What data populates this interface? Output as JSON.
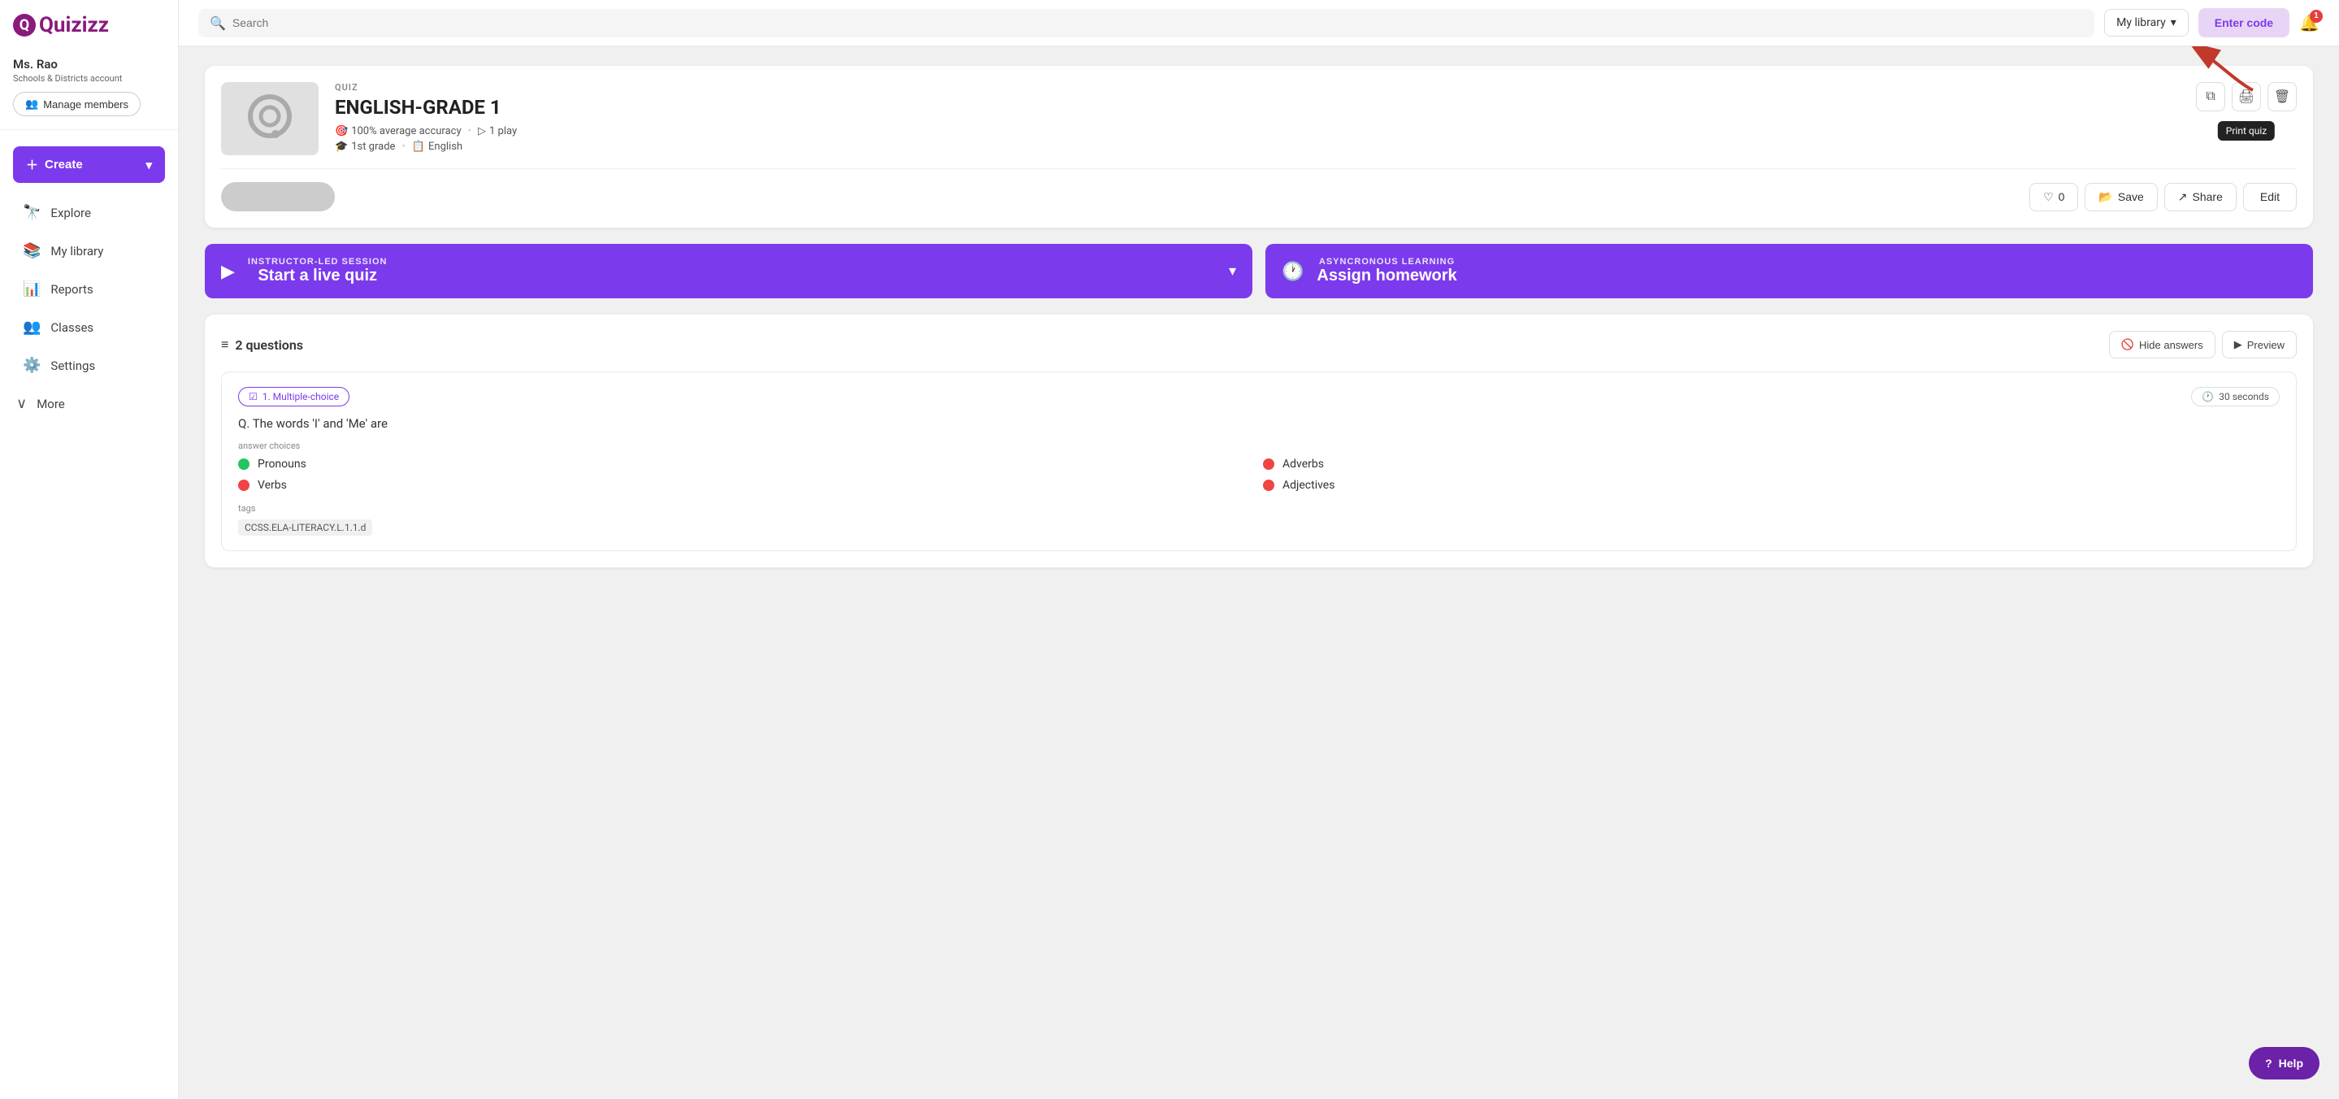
{
  "app": {
    "logo": "Quizizz"
  },
  "user": {
    "name": "Ms. Rao",
    "account_type": "Schools & Districts account"
  },
  "sidebar": {
    "manage_members_label": "Manage members",
    "create_label": "Create",
    "nav_items": [
      {
        "id": "explore",
        "label": "Explore",
        "icon": "🔭"
      },
      {
        "id": "my-library",
        "label": "My library",
        "icon": "📚"
      },
      {
        "id": "reports",
        "label": "Reports",
        "icon": "📊"
      },
      {
        "id": "classes",
        "label": "Classes",
        "icon": "👥"
      },
      {
        "id": "settings",
        "label": "Settings",
        "icon": "⚙️"
      }
    ],
    "more_label": "More"
  },
  "header": {
    "search_placeholder": "Search",
    "library_dropdown": "My library",
    "enter_code_label": "Enter code",
    "notification_count": "1"
  },
  "quiz": {
    "type_label": "QUIZ",
    "title": "ENGLISH-GRADE 1",
    "accuracy": "100% average accuracy",
    "plays": "1 play",
    "grade": "1st grade",
    "language": "English",
    "like_count": "0",
    "save_label": "Save",
    "share_label": "Share",
    "edit_label": "Edit",
    "duplicate_icon": "copy-icon",
    "print_icon": "print-icon",
    "delete_icon": "trash-icon",
    "print_tooltip": "Print quiz"
  },
  "cta": {
    "live_label_small": "INSTRUCTOR-LED SESSION",
    "live_label_large": "Start a live quiz",
    "hw_label_small": "ASYNCRONOUS LEARNING",
    "hw_label_large": "Assign homework"
  },
  "questions_section": {
    "count_label": "2 questions",
    "hide_answers_label": "Hide answers",
    "preview_label": "Preview",
    "question1": {
      "number": "1",
      "type": "Multiple-choice",
      "time": "30 seconds",
      "text": "Q. The words 'I' and 'Me' are",
      "answers_label": "answer choices",
      "answers": [
        {
          "text": "Pronouns",
          "correct": true
        },
        {
          "text": "Adverbs",
          "correct": false
        },
        {
          "text": "Verbs",
          "correct": false
        },
        {
          "text": "Adjectives",
          "correct": false
        }
      ],
      "tags_label": "tags",
      "tag": "CCSS.ELA-LITERACY.L.1.1.d"
    }
  },
  "help": {
    "label": "Help"
  }
}
